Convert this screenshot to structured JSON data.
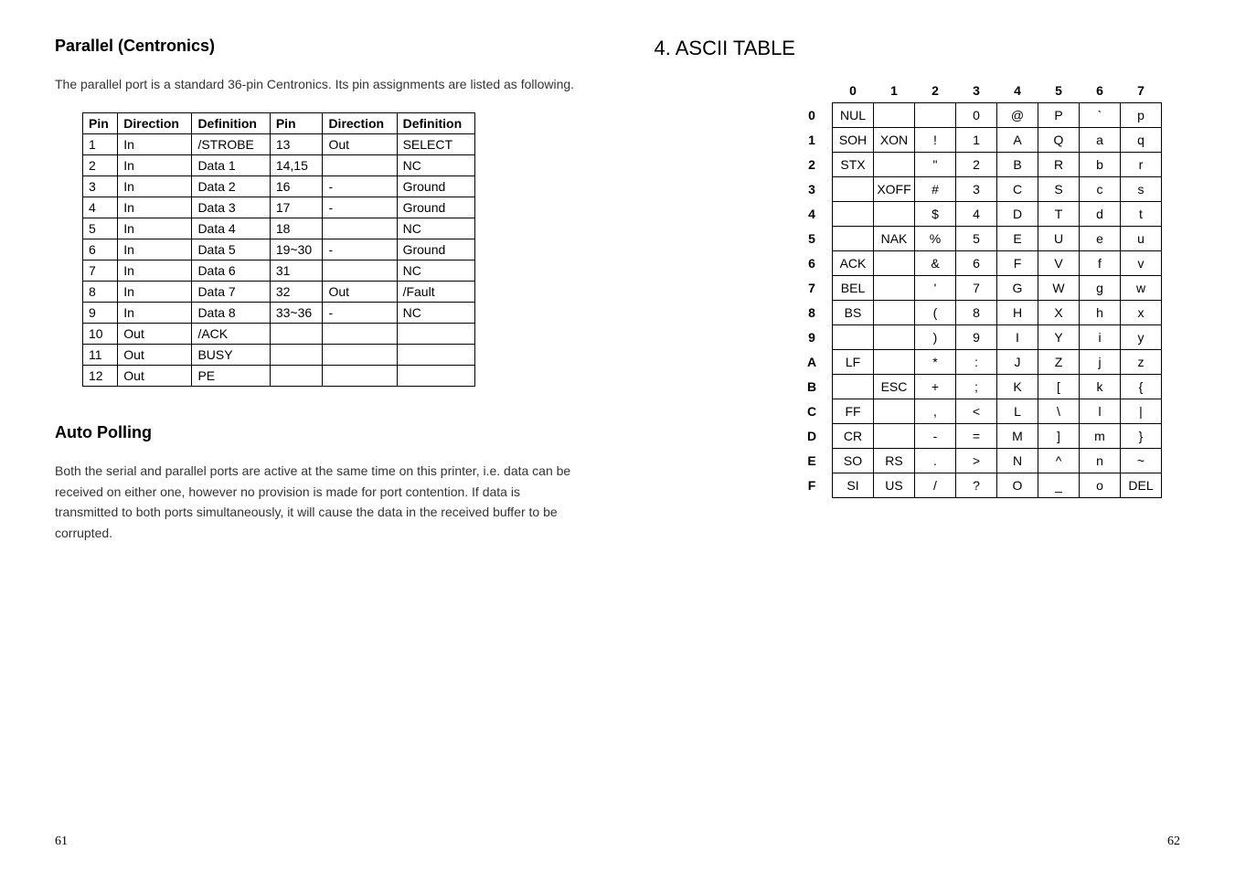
{
  "left": {
    "heading_parallel": "Parallel (Centronics)",
    "intro_parallel": "The parallel port is a standard 36-pin Centronics. Its pin assignments are listed as following.",
    "pin_headers": [
      "Pin",
      "Direction",
      "Definition",
      "Pin",
      "Direction",
      "Definition"
    ],
    "pin_rows": [
      [
        "1",
        "In",
        "/STROBE",
        "13",
        "Out",
        "SELECT"
      ],
      [
        "2",
        "In",
        "Data 1",
        "14,15",
        "",
        "NC"
      ],
      [
        "3",
        "In",
        "Data 2",
        "16",
        "-",
        "Ground"
      ],
      [
        "4",
        "In",
        "Data 3",
        "17",
        "-",
        "Ground"
      ],
      [
        "5",
        "In",
        "Data 4",
        "18",
        "",
        "NC"
      ],
      [
        "6",
        "In",
        "Data 5",
        "19~30",
        "-",
        "Ground"
      ],
      [
        "7",
        "In",
        "Data 6",
        "31",
        "",
        "NC"
      ],
      [
        "8",
        "In",
        "Data 7",
        "32",
        "Out",
        "/Fault"
      ],
      [
        "9",
        "In",
        "Data 8",
        "33~36",
        "-",
        "NC"
      ],
      [
        "10",
        "Out",
        "/ACK",
        "",
        "",
        ""
      ],
      [
        "11",
        "Out",
        "BUSY",
        "",
        "",
        ""
      ],
      [
        "12",
        "Out",
        "PE",
        "",
        "",
        ""
      ]
    ],
    "heading_auto": "Auto Polling",
    "intro_auto": "Both the serial and parallel ports are active at the same time on this printer, i.e. data can be received on either one, however no provision is made for port contention. If data is transmitted to both ports simultaneously, it will cause the data in the received buffer to be corrupted.",
    "page_num": "61"
  },
  "right": {
    "heading": "4. ASCII TABLE",
    "col_heads": [
      "0",
      "1",
      "2",
      "3",
      "4",
      "5",
      "6",
      "7"
    ],
    "row_heads": [
      "0",
      "1",
      "2",
      "3",
      "4",
      "5",
      "6",
      "7",
      "8",
      "9",
      "A",
      "B",
      "C",
      "D",
      "E",
      "F"
    ],
    "cells": [
      [
        "NUL",
        "",
        "",
        "0",
        "@",
        "P",
        "`",
        "p"
      ],
      [
        "SOH",
        "XON",
        "!",
        "1",
        "A",
        "Q",
        "a",
        "q"
      ],
      [
        "STX",
        "",
        "\"",
        "2",
        "B",
        "R",
        "b",
        "r"
      ],
      [
        "",
        "XOFF",
        "#",
        "3",
        "C",
        "S",
        "c",
        "s"
      ],
      [
        "",
        "",
        "$",
        "4",
        "D",
        "T",
        "d",
        "t"
      ],
      [
        "",
        "NAK",
        "%",
        "5",
        "E",
        "U",
        "e",
        "u"
      ],
      [
        "ACK",
        "",
        "&",
        "6",
        "F",
        "V",
        "f",
        "v"
      ],
      [
        "BEL",
        "",
        "'",
        "7",
        "G",
        "W",
        "g",
        "w"
      ],
      [
        "BS",
        "",
        "(",
        "8",
        "H",
        "X",
        "h",
        "x"
      ],
      [
        "",
        "",
        ")",
        "9",
        "I",
        "Y",
        "i",
        "y"
      ],
      [
        "LF",
        "",
        "*",
        ":",
        "J",
        "Z",
        "j",
        "z"
      ],
      [
        "",
        "ESC",
        "+",
        ";",
        "K",
        "[",
        "k",
        "{"
      ],
      [
        "FF",
        "",
        ",",
        "<",
        "L",
        "\\",
        "l",
        "|"
      ],
      [
        "CR",
        "",
        "-",
        "=",
        "M",
        "]",
        "m",
        "}"
      ],
      [
        "SO",
        "RS",
        ".",
        ">",
        "N",
        "^",
        "n",
        "~"
      ],
      [
        "SI",
        "US",
        "/",
        "?",
        "O",
        "_",
        "o",
        "DEL"
      ]
    ],
    "page_num": "62"
  }
}
